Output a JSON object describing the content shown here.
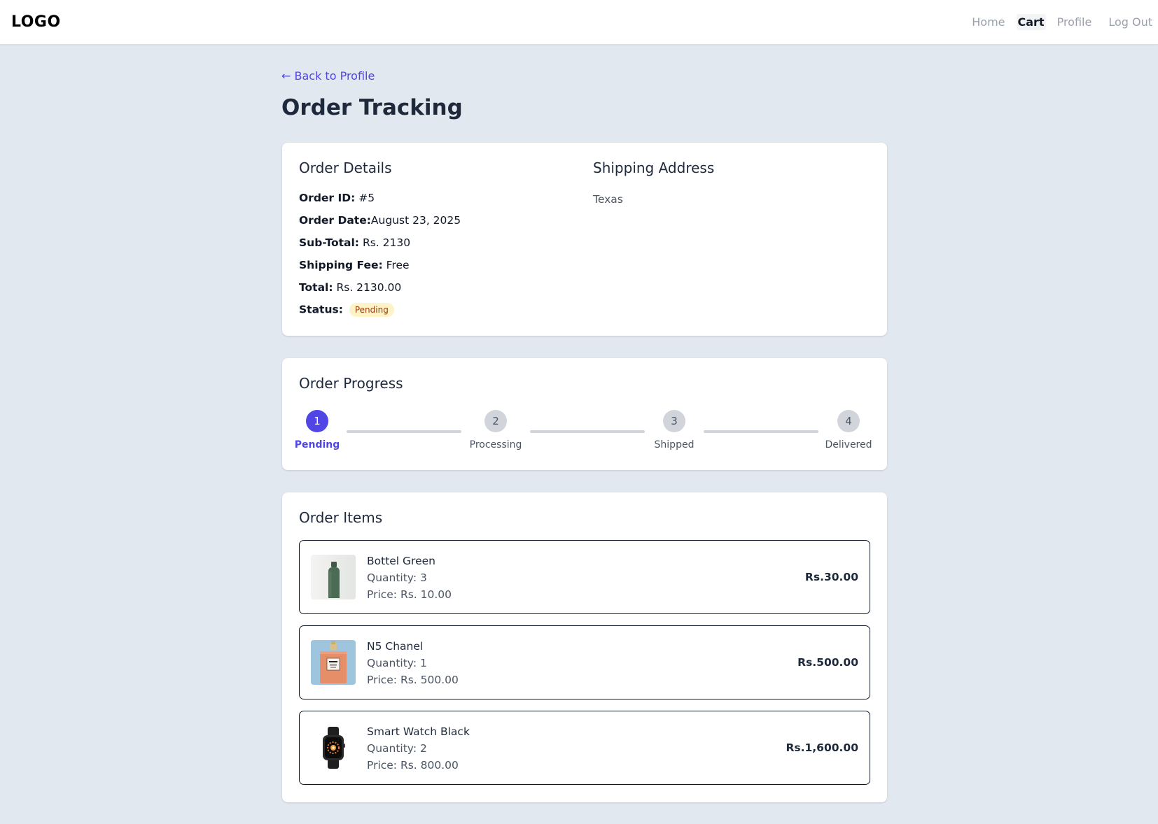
{
  "nav": {
    "logo": "LOGO",
    "links": [
      "Home",
      "Cart",
      "Profile",
      "Log Out"
    ],
    "active": "Cart"
  },
  "back_link": "← Back to Profile",
  "page_title": "Order Tracking",
  "details": {
    "title": "Order Details",
    "order_id_label": "Order ID:",
    "order_id_value": "#5",
    "order_date_label": "Order Date:",
    "order_date_value": "August 23, 2025",
    "subtotal_label": "Sub-Total:",
    "subtotal_value": "Rs. 2130",
    "shipping_fee_label": "Shipping Fee:",
    "shipping_fee_value": "Free",
    "total_label": "Total:",
    "total_value": "Rs. 2130.00",
    "status_label": "Status:",
    "status_value": "Pending"
  },
  "shipping": {
    "title": "Shipping Address",
    "address": "Texas"
  },
  "progress": {
    "title": "Order Progress",
    "steps": [
      {
        "number": "1",
        "label": "Pending"
      },
      {
        "number": "2",
        "label": "Processing"
      },
      {
        "number": "3",
        "label": "Shipped"
      },
      {
        "number": "4",
        "label": "Delivered"
      }
    ],
    "current_step": 1
  },
  "items": {
    "title": "Order Items",
    "list": [
      {
        "name": "Bottel Green",
        "quantity": "Quantity: 3",
        "price": "Price: Rs. 10.00",
        "total": "Rs.30.00",
        "thumb": "green-bottle-image"
      },
      {
        "name": "N5 Chanel",
        "quantity": "Quantity: 1",
        "price": "Price: Rs. 500.00",
        "total": "Rs.500.00",
        "thumb": "perfume-bottle-image"
      },
      {
        "name": "Smart Watch Black",
        "quantity": "Quantity: 2",
        "price": "Price: Rs. 800.00",
        "total": "Rs.1,600.00",
        "thumb": "smart-watch-image"
      }
    ]
  },
  "colors": {
    "accent": "#4f46e5",
    "background": "#e2e8f0",
    "badge_bg": "#fef3c7",
    "badge_text": "#92400e",
    "step_inactive": "#d1d5db"
  }
}
